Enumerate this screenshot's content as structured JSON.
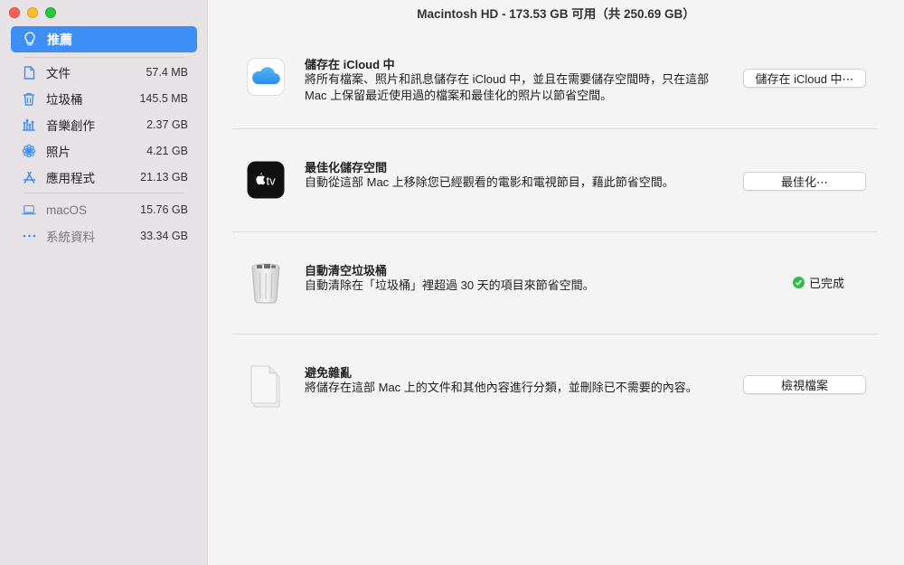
{
  "window": {
    "title": "Macintosh HD - 173.53 GB 可用（共 250.69 GB）"
  },
  "sidebar": {
    "selected": {
      "label": "推薦",
      "icon": "lightbulb-icon"
    },
    "items": [
      {
        "label": "文件",
        "size": "57.4 MB",
        "icon": "document-icon"
      },
      {
        "label": "垃圾桶",
        "size": "145.5 MB",
        "icon": "trash-icon"
      },
      {
        "label": "音樂創作",
        "size": "2.37 GB",
        "icon": "music-creation-icon"
      },
      {
        "label": "照片",
        "size": "4.21 GB",
        "icon": "photos-icon"
      },
      {
        "label": "應用程式",
        "size": "21.13 GB",
        "icon": "app-store-icon"
      }
    ],
    "system_items": [
      {
        "label": "macOS",
        "size": "15.76 GB",
        "icon": "laptop-icon"
      },
      {
        "label": "系統資料",
        "size": "33.34 GB",
        "icon": "ellipsis-icon"
      }
    ]
  },
  "recommendations": {
    "icloud": {
      "title": "儲存在 iCloud 中",
      "desc": "將所有檔案、照片和訊息儲存在 iCloud 中，並且在需要儲存空間時，只在這部 Mac 上保留最近使用過的檔案和最佳化的照片以節省空間。",
      "button": "儲存在 iCloud 中⋯"
    },
    "optimize": {
      "title": "最佳化儲存空間",
      "desc": "自動從這部 Mac 上移除您已經觀看的電影和電視節目，藉此節省空間。",
      "button": "最佳化⋯",
      "icon_text": "tv"
    },
    "empty_trash": {
      "title": "自動清空垃圾桶",
      "desc": "自動清除在「垃圾桶」裡超過 30 天的項目來節省空間。",
      "status": "已完成"
    },
    "reduce_clutter": {
      "title": "避免雜亂",
      "desc": "將儲存在這部 Mac 上的文件和其他內容進行分類，並刪除已不需要的內容。",
      "button": "檢視檔案"
    }
  },
  "colors": {
    "accent": "#3d8ff5",
    "sidebar_bg": "#e6e2e6",
    "success": "#2fbe4a"
  }
}
